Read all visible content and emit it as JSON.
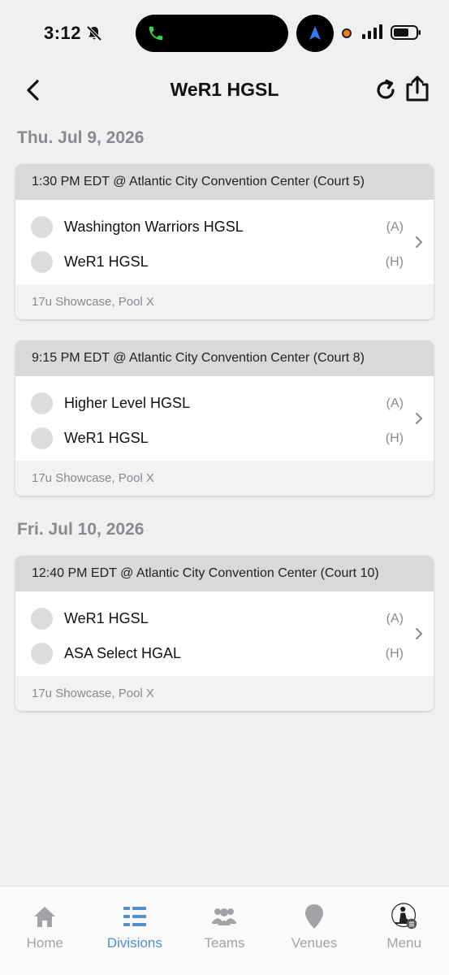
{
  "status_bar": {
    "time": "3:12"
  },
  "header": {
    "title": "WeR1 HGSL"
  },
  "days": [
    {
      "date": "Thu. Jul 9, 2026",
      "games": [
        {
          "header": "1:30 PM EDT @ Atlantic City Convention Center (Court 5)",
          "team1": {
            "name": "Washington Warriors HGSL",
            "side": "(A)"
          },
          "team2": {
            "name": "WeR1 HGSL",
            "side": "(H)"
          },
          "footer": "17u Showcase, Pool X"
        },
        {
          "header": "9:15 PM EDT @ Atlantic City Convention Center (Court 8)",
          "team1": {
            "name": "Higher Level HGSL",
            "side": "(A)"
          },
          "team2": {
            "name": "WeR1 HGSL",
            "side": "(H)"
          },
          "footer": "17u Showcase, Pool X"
        }
      ]
    },
    {
      "date": "Fri. Jul 10, 2026",
      "games": [
        {
          "header": "12:40 PM EDT @ Atlantic City Convention Center (Court 10)",
          "team1": {
            "name": "WeR1 HGSL",
            "side": "(A)"
          },
          "team2": {
            "name": "ASA Select HGAL",
            "side": "(H)"
          },
          "footer": "17u Showcase, Pool X"
        }
      ]
    }
  ],
  "tabs": [
    {
      "label": "Home",
      "icon": "home-icon"
    },
    {
      "label": "Divisions",
      "icon": "divisions-icon",
      "active": true
    },
    {
      "label": "Teams",
      "icon": "teams-icon"
    },
    {
      "label": "Venues",
      "icon": "venue-pin-icon"
    },
    {
      "label": "Menu",
      "icon": "menu-avatar-icon"
    }
  ],
  "colors": {
    "accent": "#4f8fcf",
    "inactive": "#a3a3a7",
    "card_header": "#d9d9db",
    "background": "#f0f0f2"
  }
}
